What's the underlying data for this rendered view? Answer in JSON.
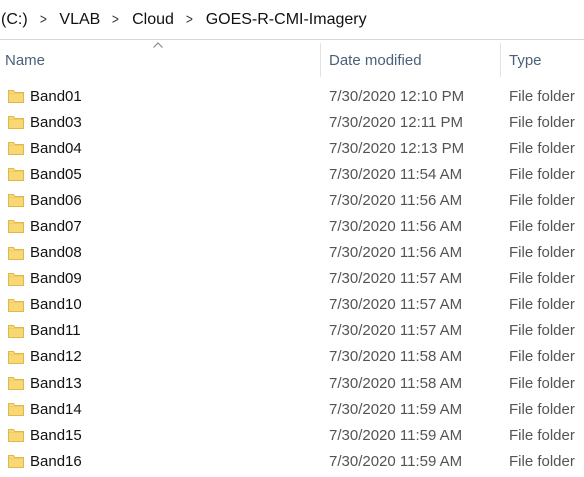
{
  "breadcrumb": {
    "items": [
      "(C:)",
      "VLAB",
      "Cloud",
      "GOES-R-CMI-Imagery"
    ],
    "separator": ">"
  },
  "columns": {
    "name": "Name",
    "date_modified": "Date modified",
    "type": "Type",
    "sort_indicator": "ascending"
  },
  "colors": {
    "header_text": "#4c607a",
    "folder_fill": "#f8d775",
    "folder_edge": "#e1b64b"
  },
  "rows": [
    {
      "name": "Band01",
      "date": "7/30/2020 12:10 PM",
      "type": "File folder",
      "icon": "folder-icon"
    },
    {
      "name": "Band03",
      "date": "7/30/2020 12:11 PM",
      "type": "File folder",
      "icon": "folder-icon"
    },
    {
      "name": "Band04",
      "date": "7/30/2020 12:13 PM",
      "type": "File folder",
      "icon": "folder-icon"
    },
    {
      "name": "Band05",
      "date": "7/30/2020 11:54 AM",
      "type": "File folder",
      "icon": "folder-icon"
    },
    {
      "name": "Band06",
      "date": "7/30/2020 11:56 AM",
      "type": "File folder",
      "icon": "folder-icon"
    },
    {
      "name": "Band07",
      "date": "7/30/2020 11:56 AM",
      "type": "File folder",
      "icon": "folder-icon"
    },
    {
      "name": "Band08",
      "date": "7/30/2020 11:56 AM",
      "type": "File folder",
      "icon": "folder-icon"
    },
    {
      "name": "Band09",
      "date": "7/30/2020 11:57 AM",
      "type": "File folder",
      "icon": "folder-icon"
    },
    {
      "name": "Band10",
      "date": "7/30/2020 11:57 AM",
      "type": "File folder",
      "icon": "folder-icon"
    },
    {
      "name": "Band11",
      "date": "7/30/2020 11:57 AM",
      "type": "File folder",
      "icon": "folder-icon"
    },
    {
      "name": "Band12",
      "date": "7/30/2020 11:58 AM",
      "type": "File folder",
      "icon": "folder-icon"
    },
    {
      "name": "Band13",
      "date": "7/30/2020 11:58 AM",
      "type": "File folder",
      "icon": "folder-icon"
    },
    {
      "name": "Band14",
      "date": "7/30/2020 11:59 AM",
      "type": "File folder",
      "icon": "folder-icon"
    },
    {
      "name": "Band15",
      "date": "7/30/2020 11:59 AM",
      "type": "File folder",
      "icon": "folder-icon"
    },
    {
      "name": "Band16",
      "date": "7/30/2020 11:59 AM",
      "type": "File folder",
      "icon": "folder-icon"
    }
  ]
}
